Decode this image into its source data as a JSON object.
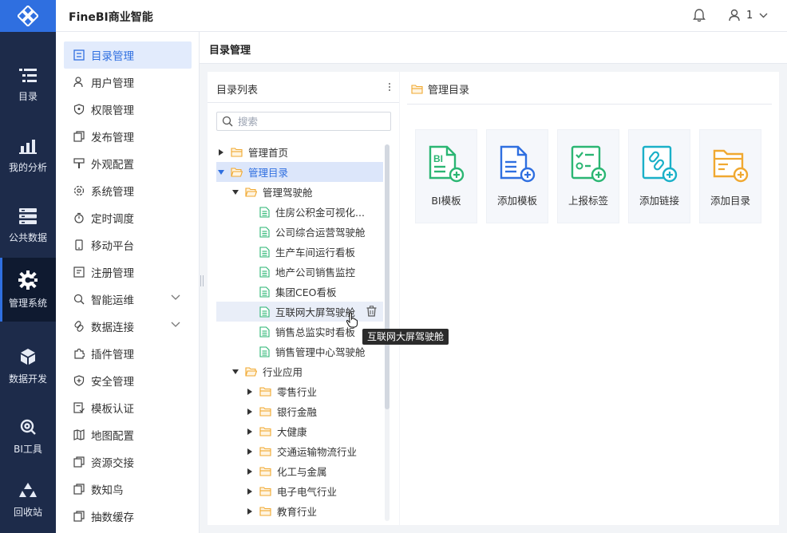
{
  "app": {
    "title": "FineBI商业智能",
    "user_name": "1"
  },
  "rail": [
    {
      "label": "目录",
      "icon": "catalog-icon"
    },
    {
      "label": "我的分析",
      "icon": "analysis-icon"
    },
    {
      "label": "公共数据",
      "icon": "database-icon"
    },
    {
      "label": "管理系统",
      "icon": "gear-icon",
      "active": true
    },
    {
      "label": "数据开发",
      "icon": "cube-icon"
    },
    {
      "label": "BI工具",
      "icon": "tools-icon"
    },
    {
      "label": "回收站",
      "icon": "recycle-icon"
    }
  ],
  "submenu": [
    {
      "label": "目录管理",
      "active": true
    },
    {
      "label": "用户管理"
    },
    {
      "label": "权限管理"
    },
    {
      "label": "发布管理"
    },
    {
      "label": "外观配置"
    },
    {
      "label": "系统管理"
    },
    {
      "label": "定时调度"
    },
    {
      "label": "移动平台"
    },
    {
      "label": "注册管理"
    },
    {
      "label": "智能运维",
      "expandable": true
    },
    {
      "label": "数据连接",
      "expandable": true
    },
    {
      "label": "插件管理"
    },
    {
      "label": "安全管理"
    },
    {
      "label": "模板认证"
    },
    {
      "label": "地图配置"
    },
    {
      "label": "资源交接"
    },
    {
      "label": "数知鸟"
    },
    {
      "label": "抽数缓存"
    }
  ],
  "page": {
    "title": "目录管理"
  },
  "left_panel": {
    "title": "目录列表",
    "search_placeholder": "搜索",
    "tree": [
      {
        "label": "管理首页",
        "level": 0,
        "type": "folder",
        "state": "collapsed"
      },
      {
        "label": "管理目录",
        "level": 0,
        "type": "folder",
        "state": "expanded",
        "selected": true
      },
      {
        "label": "管理驾驶舱",
        "level": 1,
        "type": "folder",
        "state": "expanded"
      },
      {
        "label": "住房公积金可视化...",
        "level": 2,
        "type": "file"
      },
      {
        "label": "公司综合运营驾驶舱",
        "level": 2,
        "type": "file"
      },
      {
        "label": "生产车间运行看板",
        "level": 2,
        "type": "file"
      },
      {
        "label": "地产公司销售监控",
        "level": 2,
        "type": "file"
      },
      {
        "label": "集团CEO看板",
        "level": 2,
        "type": "file"
      },
      {
        "label": "互联网大屏驾驶舱",
        "level": 2,
        "type": "file",
        "hover": true
      },
      {
        "label": "销售总监实时看板",
        "level": 2,
        "type": "file"
      },
      {
        "label": "销售管理中心驾驶舱",
        "level": 2,
        "type": "file"
      },
      {
        "label": "行业应用",
        "level": 1,
        "type": "folder",
        "state": "expanded"
      },
      {
        "label": "零售行业",
        "level": 2,
        "type": "folder",
        "state": "collapsed"
      },
      {
        "label": "银行金融",
        "level": 2,
        "type": "folder",
        "state": "collapsed"
      },
      {
        "label": "大健康",
        "level": 2,
        "type": "folder",
        "state": "collapsed"
      },
      {
        "label": "交通运输物流行业",
        "level": 2,
        "type": "folder",
        "state": "collapsed"
      },
      {
        "label": "化工与金属",
        "level": 2,
        "type": "folder",
        "state": "collapsed"
      },
      {
        "label": "电子电气行业",
        "level": 2,
        "type": "folder",
        "state": "collapsed"
      },
      {
        "label": "教育行业",
        "level": 2,
        "type": "folder",
        "state": "collapsed"
      }
    ],
    "tooltip": "互联网大屏驾驶舱"
  },
  "right_panel": {
    "title": "管理目录",
    "cards": [
      {
        "label": "BI模板",
        "icon": "bi-template-add-icon",
        "color": "#2bb673"
      },
      {
        "label": "添加模板",
        "icon": "template-add-icon",
        "color": "#2f6fe0"
      },
      {
        "label": "上报标签",
        "icon": "report-tag-add-icon",
        "color": "#2bb673"
      },
      {
        "label": "添加链接",
        "icon": "link-add-icon",
        "color": "#1ab0c8"
      },
      {
        "label": "添加目录",
        "icon": "folder-add-icon",
        "color": "#f0a830"
      }
    ]
  },
  "colors": {
    "accent": "#2f6fe0",
    "rail_bg": "#1d2b4a",
    "folder": "#f0a830",
    "file": "#2bb673"
  }
}
